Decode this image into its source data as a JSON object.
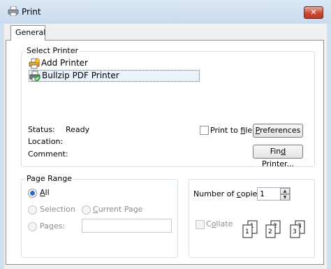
{
  "window": {
    "title": "Print",
    "close_glyph": "✕"
  },
  "tabs": [
    {
      "label": "General"
    }
  ],
  "select_printer": {
    "label": "Select Printer",
    "printers": [
      {
        "name": "Add Printer",
        "icon": "add-printer-icon"
      },
      {
        "name": "Bullzip PDF Printer",
        "icon": "pdf-printer-icon",
        "selected": true
      }
    ],
    "status_label": "Status:",
    "status_value": "Ready",
    "location_label": "Location:",
    "location_value": "",
    "comment_label": "Comment:",
    "comment_value": "",
    "print_to_file": {
      "pre": "Print to ",
      "key": "f",
      "post": "ile",
      "checked": false
    },
    "preferences_button": {
      "pre": "",
      "key": "P",
      "post": "references"
    },
    "find_printer_button": {
      "pre": "Fin",
      "key": "d",
      "post": " Printer..."
    }
  },
  "page_range": {
    "label": "Page Range",
    "all": {
      "pre": "",
      "key": "A",
      "post": "ll",
      "selected": true
    },
    "selection": {
      "label": "Selection",
      "enabled": false
    },
    "current_page": {
      "pre": "",
      "key": "C",
      "post": "urrent Page",
      "enabled": false
    },
    "pages": {
      "pre": "Pa",
      "key": "g",
      "post": "es:",
      "enabled": false,
      "value": ""
    }
  },
  "copies": {
    "label": {
      "pre": "Number of ",
      "key": "c",
      "post": "opies:"
    },
    "value": "1",
    "collate": {
      "pre": "C",
      "key": "o",
      "post": "llate",
      "checked": false,
      "enabled": false
    },
    "collate_pages": [
      "1",
      "1",
      "2",
      "2",
      "3",
      "3"
    ]
  },
  "colors": {
    "close": "#c94a35",
    "accent": "#2a6bd2"
  }
}
